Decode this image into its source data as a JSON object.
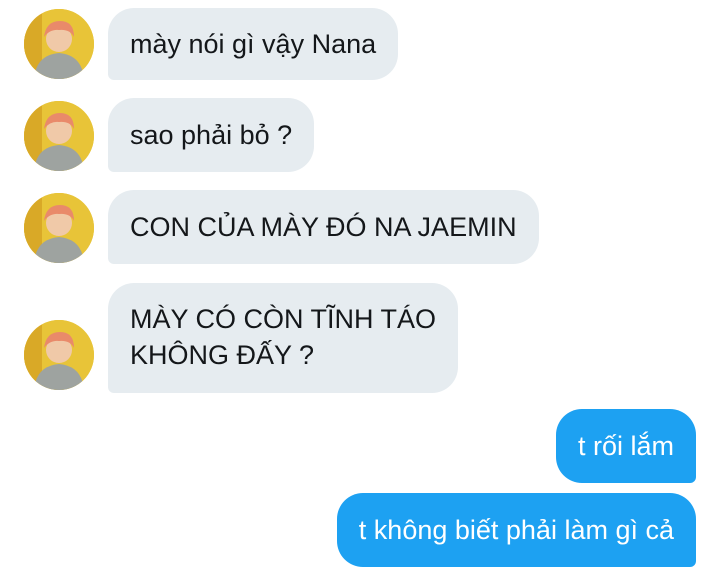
{
  "conversation": {
    "messages": [
      {
        "direction": "incoming",
        "text": "mày nói gì vậy Nana"
      },
      {
        "direction": "incoming",
        "text": "sao phải bỏ ?"
      },
      {
        "direction": "incoming",
        "text": "CON CỦA MÀY ĐÓ NA JAEMIN"
      },
      {
        "direction": "incoming",
        "lines": [
          "MÀY CÓ CÒN TĨNH TÁO",
          "KHÔNG ĐẤY ?"
        ]
      },
      {
        "direction": "outgoing",
        "text": "t rối lắm"
      },
      {
        "direction": "outgoing",
        "text": "t không biết phải làm gì cả"
      }
    ]
  },
  "colors": {
    "incoming_bubble": "#e6ecf0",
    "incoming_text": "#14171a",
    "outgoing_bubble": "#1da1f2",
    "outgoing_text": "#ffffff"
  },
  "icons": {
    "sender_avatar": "person-avatar-photo"
  }
}
